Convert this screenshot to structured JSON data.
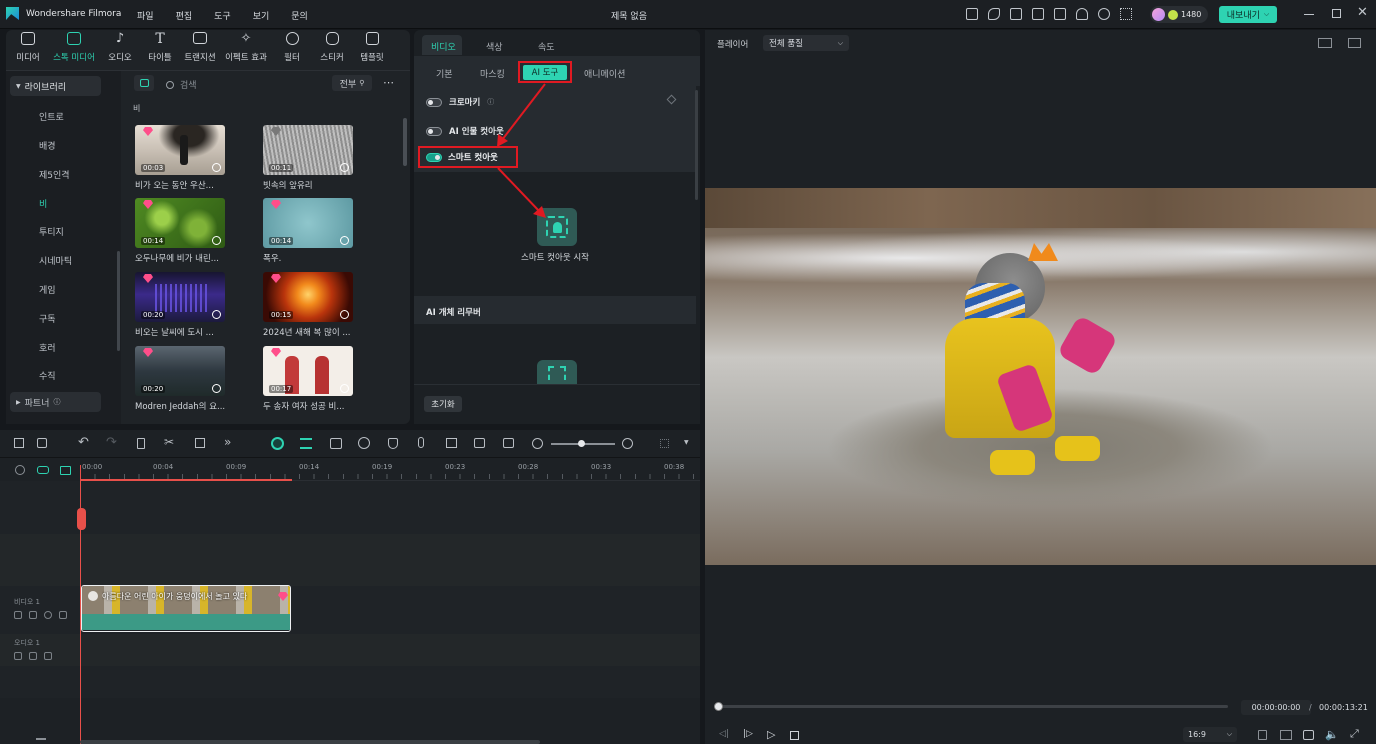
{
  "app": {
    "name": "Wondershare Filmora",
    "menu": [
      "파일",
      "편집",
      "도구",
      "보기",
      "문의"
    ],
    "project_title": "제목 없음",
    "credits": "1480",
    "export_label": "내보내기"
  },
  "media_nav": [
    {
      "label": "미디어",
      "icon": "media-icon"
    },
    {
      "label": "스톡 미디어",
      "icon": "stock-media-icon",
      "active": true
    },
    {
      "label": "오디오",
      "icon": "audio-icon"
    },
    {
      "label": "타이틀",
      "icon": "title-icon"
    },
    {
      "label": "트랜지션",
      "icon": "transition-icon"
    },
    {
      "label": "이펙트 효과",
      "icon": "effects-icon"
    },
    {
      "label": "필터",
      "icon": "filter-icon"
    },
    {
      "label": "스티커",
      "icon": "sticker-icon"
    },
    {
      "label": "템플릿",
      "icon": "template-icon"
    }
  ],
  "library": {
    "header": "라이브러리",
    "items": [
      "인트로",
      "배경",
      "제5인격",
      "비",
      "투티지",
      "시네마틱",
      "게임",
      "구독",
      "호러",
      "수직"
    ],
    "active_item": "비",
    "partner": "파트너"
  },
  "stock": {
    "search_placeholder": "검색",
    "filter_label": "전부",
    "section": "비",
    "items": [
      {
        "duration": "00:03",
        "title": "비가 오는 동안 우산..."
      },
      {
        "duration": "00:11",
        "title": "빗속의 앞유리"
      },
      {
        "duration": "00:14",
        "title": "오두나무에 비가 내린..."
      },
      {
        "duration": "00:14",
        "title": "폭우."
      },
      {
        "duration": "00:20",
        "title": "비오는 날씨에 도시 ..."
      },
      {
        "duration": "00:15",
        "title": "2024년 새해 복 많이 ..."
      },
      {
        "duration": "00:20",
        "title": "Modren Jeddah의 요..."
      },
      {
        "duration": "00:17",
        "title": "두 송자 여자 성공 비..."
      }
    ]
  },
  "properties": {
    "main_tabs": [
      "비디오",
      "색상",
      "속도"
    ],
    "sub_tabs": [
      "기본",
      "마스킹",
      "AI 도구",
      "애니메이션"
    ],
    "options": [
      {
        "label": "크로마키",
        "on": false
      },
      {
        "label": "AI 인물 컷아웃",
        "on": false
      },
      {
        "label": "스마트 컷아웃",
        "on": true
      }
    ],
    "start_cutout": "스마트 컷아웃 시작",
    "remover_header": "AI 개체 리무버",
    "reset": "초기화"
  },
  "player": {
    "label": "플레이어",
    "quality": "전체 품질",
    "current_time": "00:00:00:00",
    "separator": "/",
    "total_time": "00:00:13:21",
    "aspect": "16:9",
    "progress": 0
  },
  "timeline": {
    "ticks": [
      "00:00",
      "00:04",
      "00:09",
      "00:14",
      "00:19",
      "00:23",
      "00:28",
      "00:33",
      "00:38"
    ],
    "tracks": [
      {
        "label": "비디오 1"
      },
      {
        "label": "오디오 1"
      }
    ],
    "clip_title": "아름다운 어린 아이가 웅덩이에서 놀고 있다",
    "colors": {
      "accent": "#2ed3b2",
      "playhead": "#e8504a",
      "clip": "#3c9a86",
      "highlight": "#e01a22"
    }
  }
}
